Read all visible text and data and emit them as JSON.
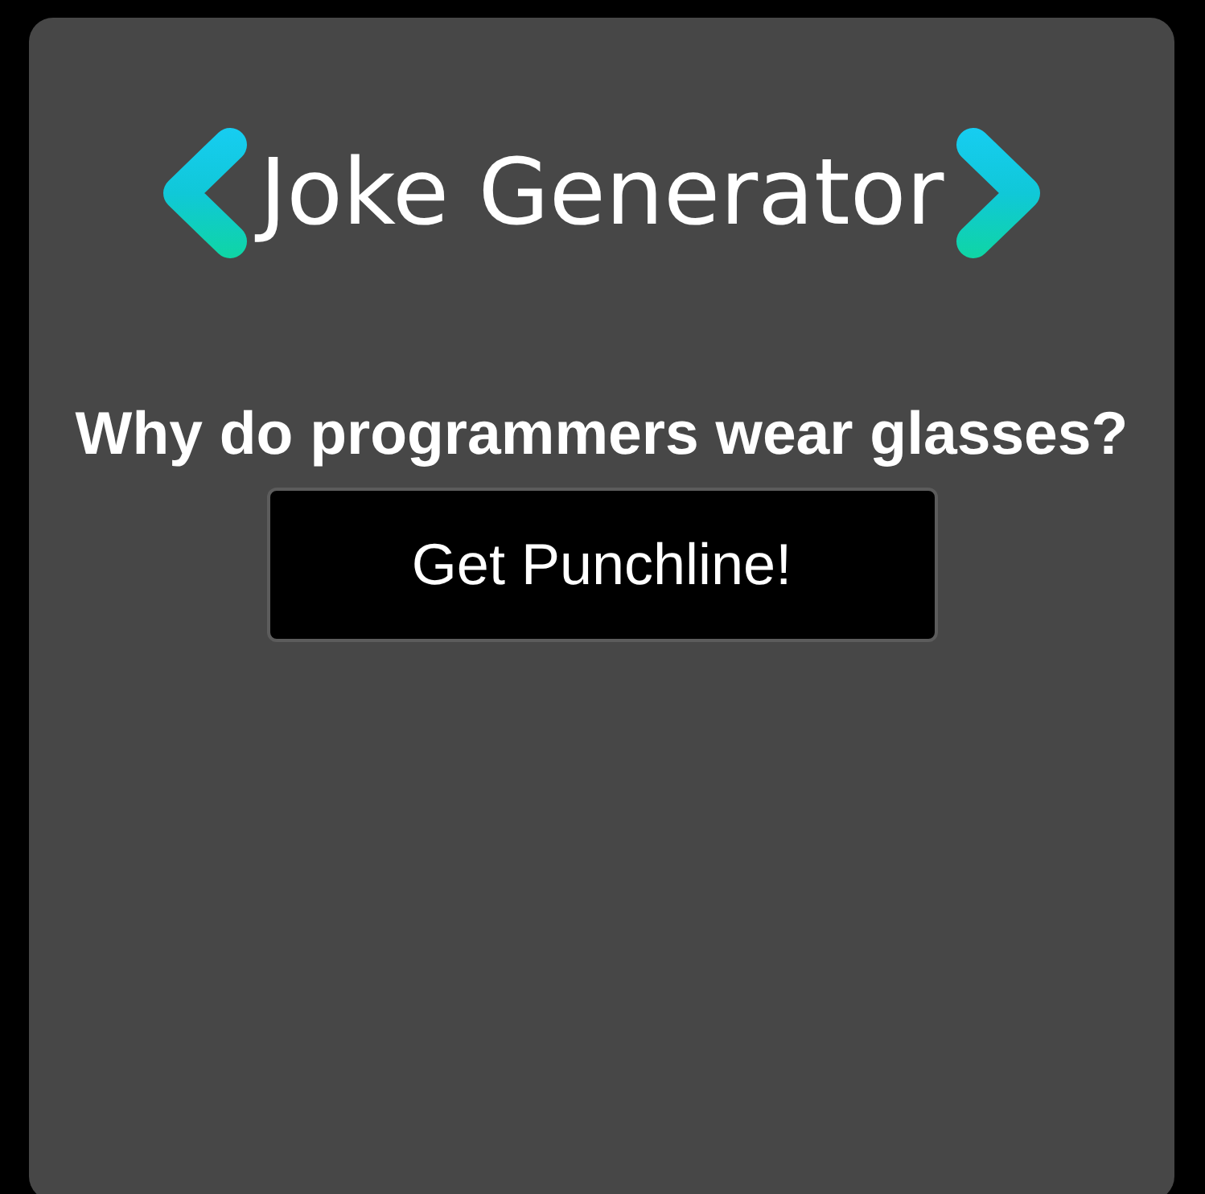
{
  "header": {
    "title": "Joke Generator"
  },
  "joke": {
    "question": "Why do programmers wear glasses?"
  },
  "button": {
    "label": "Get Punchline!"
  }
}
